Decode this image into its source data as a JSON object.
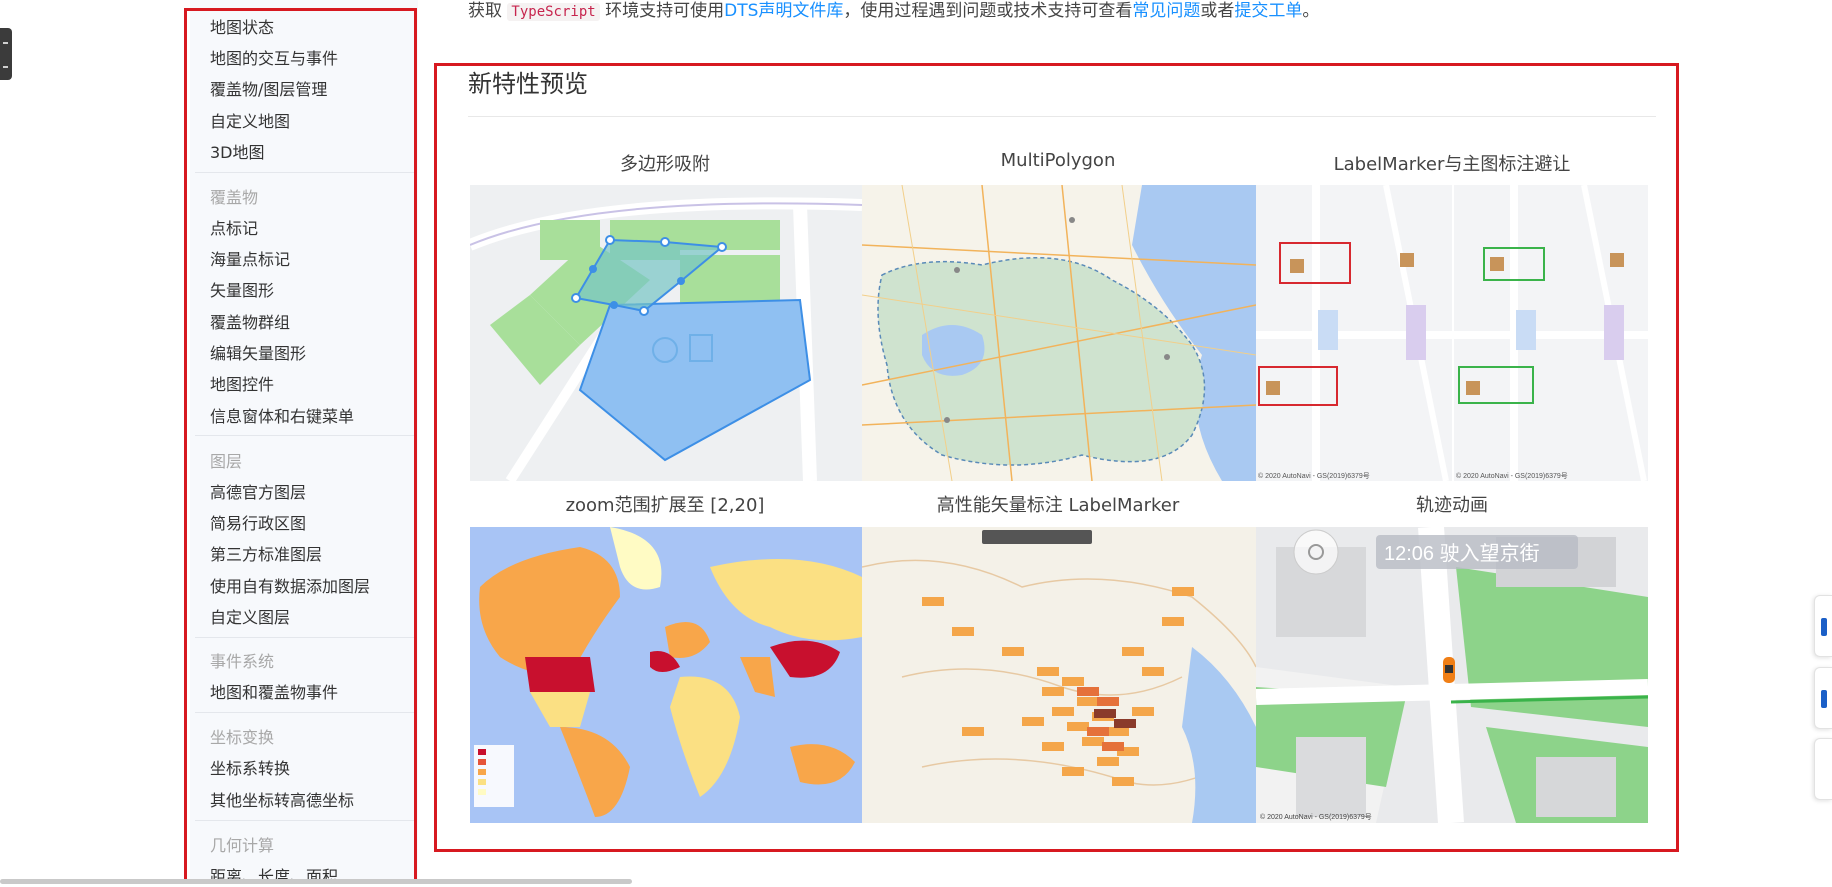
{
  "sidebar": {
    "top_items": [
      "地图状态",
      "地图的交互与事件",
      "覆盖物/图层管理",
      "自定义地图",
      "3D地图"
    ],
    "groups": [
      {
        "title": "覆盖物",
        "items": [
          "点标记",
          "海量点标记",
          "矢量图形",
          "覆盖物群组",
          "编辑矢量图形",
          "地图控件",
          "信息窗体和右键菜单"
        ]
      },
      {
        "title": "图层",
        "items": [
          "高德官方图层",
          "简易行政区图",
          "第三方标准图层",
          "使用自有数据添加图层",
          "自定义图层"
        ]
      },
      {
        "title": "事件系统",
        "items": [
          "地图和覆盖物事件"
        ]
      },
      {
        "title": "坐标变换",
        "items": [
          "坐标系转换",
          "其他坐标转高德坐标"
        ]
      },
      {
        "title": "几何计算",
        "items": [
          "距离、长度、面积"
        ]
      }
    ]
  },
  "intro": {
    "prefix": "获取",
    "code": "TypeScript",
    "mid": "环境支持可使用",
    "link1": "DTS声明文件库",
    "mid2": "，使用过程遇到问题或技术支持可查看",
    "link2": "常见问题",
    "mid3": "或者",
    "link3": "提交工单",
    "suffix": "。"
  },
  "section": {
    "title": "新特性预览",
    "features": [
      {
        "caption": "多边形吸附"
      },
      {
        "caption": "MultiPolygon"
      },
      {
        "caption": "LabelMarker与主图标注避让"
      },
      {
        "caption": "zoom范围扩展至 [2,20]"
      },
      {
        "caption": "高性能矢量标注 LabelMarker"
      },
      {
        "caption": "轨迹动画"
      }
    ]
  },
  "tile_text": {
    "nav_banner": "12:06 驶入望京街",
    "attribution": "© 2020 AutoNavi - GS(2019)6379号"
  },
  "colors": {
    "accent_red": "#d71920",
    "link_blue": "#1890ff"
  }
}
